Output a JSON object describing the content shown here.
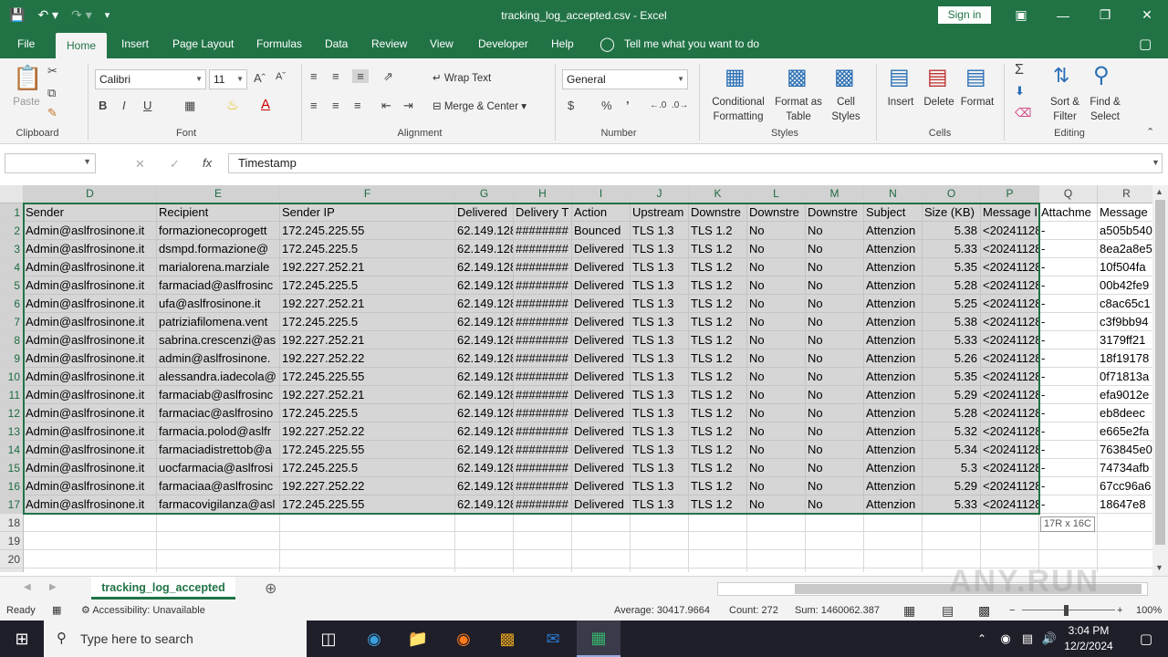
{
  "title_bar": {
    "title": "tracking_log_accepted.csv - Excel",
    "sign_in": "Sign in"
  },
  "menu": {
    "tabs": [
      "File",
      "Home",
      "Insert",
      "Page Layout",
      "Formulas",
      "Data",
      "Review",
      "View",
      "Developer",
      "Help"
    ],
    "tell_me": "Tell me what you want to do",
    "active": "Home"
  },
  "ribbon": {
    "clipboard": {
      "paste": "Paste",
      "label": "Clipboard"
    },
    "font": {
      "name": "Calibri",
      "size": "11",
      "label": "Font",
      "bold": "B",
      "italic": "I",
      "underline": "U"
    },
    "alignment": {
      "wrap": "Wrap Text",
      "merge": "Merge & Center",
      "label": "Alignment"
    },
    "number": {
      "format": "General",
      "label": "Number",
      "currency": "$",
      "percent": "%",
      "comma": "’"
    },
    "styles": {
      "conditional_1": "Conditional",
      "conditional_2": "Formatting",
      "format_table_1": "Format as",
      "format_table_2": "Table",
      "cell_styles_1": "Cell",
      "cell_styles_2": "Styles",
      "label": "Styles"
    },
    "cells": {
      "insert": "Insert",
      "delete": "Delete",
      "format": "Format",
      "label": "Cells"
    },
    "editing": {
      "sort_1": "Sort &",
      "sort_2": "Filter",
      "find_1": "Find &",
      "find_2": "Select",
      "label": "Editing"
    }
  },
  "formula_bar": {
    "name_box": "",
    "fx": "fx",
    "content": "Timestamp"
  },
  "grid": {
    "columns": [
      "D",
      "E",
      "F",
      "G",
      "H",
      "I",
      "J",
      "K",
      "L",
      "M",
      "N",
      "O",
      "P",
      "Q",
      "R"
    ],
    "header_row": [
      "Sender",
      "Recipient",
      "Sender IP",
      "Delivered",
      "Delivery T",
      "Action",
      "Upstream",
      "Downstre",
      "Downstre",
      "Downstre",
      "Subject",
      "Size (KB)",
      "Message I",
      "Attachme",
      "Message"
    ],
    "rows": [
      [
        "Admin@aslfrosinone.it",
        "formazionecoprogett",
        "172.245.225.55",
        "62.149.128",
        "########",
        "Bounced",
        "TLS 1.3",
        "TLS 1.2",
        "No",
        "No",
        "Attenzion",
        "5.38",
        "<20241128",
        "-",
        "a505b540"
      ],
      [
        "Admin@aslfrosinone.it",
        "dsmpd.formazione@",
        "172.245.225.5",
        "62.149.128",
        "########",
        "Delivered",
        "TLS 1.3",
        "TLS 1.2",
        "No",
        "No",
        "Attenzion",
        "5.33",
        "<20241128",
        "-",
        "8ea2a8e5"
      ],
      [
        "Admin@aslfrosinone.it",
        "marialorena.marziale",
        "192.227.252.21",
        "62.149.128",
        "########",
        "Delivered",
        "TLS 1.3",
        "TLS 1.2",
        "No",
        "No",
        "Attenzion",
        "5.35",
        "<20241128",
        "-",
        "10f504fa"
      ],
      [
        "Admin@aslfrosinone.it",
        "farmaciad@aslfrosinc",
        "172.245.225.5",
        "62.149.128",
        "########",
        "Delivered",
        "TLS 1.3",
        "TLS 1.2",
        "No",
        "No",
        "Attenzion",
        "5.28",
        "<20241128",
        "-",
        "00b42fe9"
      ],
      [
        "Admin@aslfrosinone.it",
        "ufa@aslfrosinone.it",
        "192.227.252.21",
        "62.149.128",
        "########",
        "Delivered",
        "TLS 1.3",
        "TLS 1.2",
        "No",
        "No",
        "Attenzion",
        "5.25",
        "<20241128",
        "-",
        "c8ac65c1"
      ],
      [
        "Admin@aslfrosinone.it",
        "patriziafilomena.vent",
        "172.245.225.5",
        "62.149.128",
        "########",
        "Delivered",
        "TLS 1.3",
        "TLS 1.2",
        "No",
        "No",
        "Attenzion",
        "5.38",
        "<20241128",
        "-",
        "c3f9bb94"
      ],
      [
        "Admin@aslfrosinone.it",
        "sabrina.crescenzi@as",
        "192.227.252.21",
        "62.149.128",
        "########",
        "Delivered",
        "TLS 1.3",
        "TLS 1.2",
        "No",
        "No",
        "Attenzion",
        "5.33",
        "<20241128",
        "-",
        "3179ff21"
      ],
      [
        "Admin@aslfrosinone.it",
        "admin@aslfrosinone.",
        "192.227.252.22",
        "62.149.128",
        "########",
        "Delivered",
        "TLS 1.3",
        "TLS 1.2",
        "No",
        "No",
        "Attenzion",
        "5.26",
        "<20241128",
        "-",
        "18f19178"
      ],
      [
        "Admin@aslfrosinone.it",
        "alessandra.iadecola@",
        "172.245.225.55",
        "62.149.128",
        "########",
        "Delivered",
        "TLS 1.3",
        "TLS 1.2",
        "No",
        "No",
        "Attenzion",
        "5.35",
        "<20241128",
        "-",
        "0f71813a"
      ],
      [
        "Admin@aslfrosinone.it",
        "farmaciab@aslfrosinc",
        "192.227.252.21",
        "62.149.128",
        "########",
        "Delivered",
        "TLS 1.3",
        "TLS 1.2",
        "No",
        "No",
        "Attenzion",
        "5.29",
        "<20241128",
        "-",
        "efa9012e"
      ],
      [
        "Admin@aslfrosinone.it",
        "farmaciac@aslfrosino",
        "172.245.225.5",
        "62.149.128",
        "########",
        "Delivered",
        "TLS 1.3",
        "TLS 1.2",
        "No",
        "No",
        "Attenzion",
        "5.28",
        "<20241128",
        "-",
        "eb8deec"
      ],
      [
        "Admin@aslfrosinone.it",
        "farmacia.polod@aslfr",
        "192.227.252.22",
        "62.149.128",
        "########",
        "Delivered",
        "TLS 1.3",
        "TLS 1.2",
        "No",
        "No",
        "Attenzion",
        "5.32",
        "<20241128",
        "-",
        "e665e2fa"
      ],
      [
        "Admin@aslfrosinone.it",
        "farmaciadistrettob@a",
        "172.245.225.55",
        "62.149.128",
        "########",
        "Delivered",
        "TLS 1.3",
        "TLS 1.2",
        "No",
        "No",
        "Attenzion",
        "5.34",
        "<20241128",
        "-",
        "763845e0"
      ],
      [
        "Admin@aslfrosinone.it",
        "uocfarmacia@aslfrosi",
        "172.245.225.5",
        "62.149.128",
        "########",
        "Delivered",
        "TLS 1.3",
        "TLS 1.2",
        "No",
        "No",
        "Attenzion",
        "5.3",
        "<20241128",
        "-",
        "74734afb"
      ],
      [
        "Admin@aslfrosinone.it",
        "farmaciaa@aslfrosinc",
        "192.227.252.22",
        "62.149.128",
        "########",
        "Delivered",
        "TLS 1.3",
        "TLS 1.2",
        "No",
        "No",
        "Attenzion",
        "5.29",
        "<20241128",
        "-",
        "67cc96a6"
      ],
      [
        "Admin@aslfrosinone.it",
        "farmacovigilanza@asl",
        "172.245.225.55",
        "62.149.128",
        "########",
        "Delivered",
        "TLS 1.3",
        "TLS 1.2",
        "No",
        "No",
        "Attenzion",
        "5.33",
        "<20241128",
        "-",
        "18647e8"
      ]
    ],
    "row_numbers": [
      "1",
      "2",
      "3",
      "4",
      "5",
      "6",
      "7",
      "8",
      "9",
      "10",
      "11",
      "12",
      "13",
      "14",
      "15",
      "16",
      "17",
      "18",
      "19",
      "20",
      "21"
    ],
    "selection_tip": "17R x 16C"
  },
  "sheet_tabs": {
    "active": "tracking_log_accepted"
  },
  "status_bar": {
    "ready": "Ready",
    "accessibility": "Accessibility: Unavailable",
    "average": "Average: 30417.9664",
    "count": "Count: 272",
    "sum": "Sum: 1460062.387",
    "zoom": "100%"
  },
  "taskbar": {
    "search_placeholder": "Type here to search",
    "time": "3:04 PM",
    "date": "12/2/2024"
  },
  "watermark": "ANY.RUN",
  "colors": {
    "excel_green": "#217346",
    "selection_fill": "#d6d6d6",
    "taskbar": "#1f1f2a"
  }
}
